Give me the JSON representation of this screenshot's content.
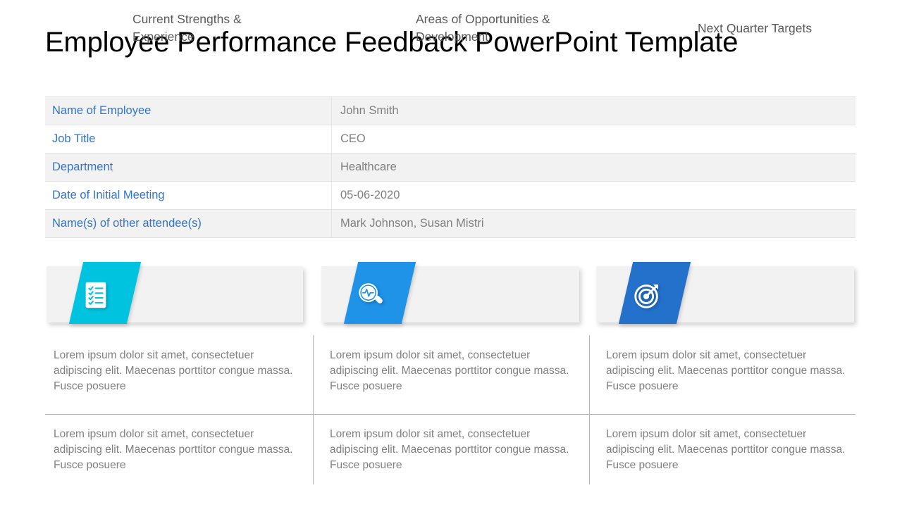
{
  "title": "Employee Performance Feedback PowerPoint Template",
  "colors": {
    "label_blue": "#2e75d4",
    "value_gray": "#7f7f7f",
    "slab_cyan": "#00c3e0",
    "slab_blue": "#1f93e8",
    "slab_dark_blue": "#2471cc",
    "header_bg": "#f2f2f2",
    "row_shaded": "#f2f2f2",
    "divider": "#b7b7b7"
  },
  "info_table": {
    "rows": [
      {
        "label": "Name of Employee",
        "value": "John Smith"
      },
      {
        "label": "Job Title",
        "value": "CEO"
      },
      {
        "label": "Department",
        "value": "Healthcare"
      },
      {
        "label": "Date of Initial Meeting",
        "value": "05-06-2020"
      },
      {
        "label": "Name(s) of other  attendee(s)",
        "value": "Mark Johnson, Susan Mistri"
      }
    ]
  },
  "cards": [
    {
      "title": "Current Strengths & Experience",
      "icon": "checklist-icon",
      "color": "#00c3e0"
    },
    {
      "title": "Areas of Opportunities & Development",
      "icon": "magnifier-pulse-icon",
      "color": "#1f93e8"
    },
    {
      "title": "Next Quarter Targets",
      "icon": "target-arrow-icon",
      "color": "#2471cc"
    }
  ],
  "body": {
    "col1": {
      "row1": "Lorem ipsum dolor sit amet, consectetuer adipiscing elit. Maecenas porttitor congue massa. Fusce posuere",
      "row2": "Lorem ipsum dolor sit amet, consectetuer adipiscing elit. Maecenas porttitor congue massa. Fusce posuere"
    },
    "col2": {
      "row1": "Lorem ipsum dolor sit amet, consectetuer adipiscing elit. Maecenas porttitor congue massa. Fusce posuere",
      "row2": "Lorem ipsum dolor sit amet, consectetuer adipiscing elit. Maecenas porttitor congue massa. Fusce posuere"
    },
    "col3": {
      "row1": "Lorem ipsum dolor sit amet, consectetuer adipiscing elit. Maecenas porttitor congue massa. Fusce posuere",
      "row2": "Lorem ipsum dolor sit amet, consectetuer adipiscing elit. Maecenas porttitor congue massa. Fusce posuere"
    }
  }
}
